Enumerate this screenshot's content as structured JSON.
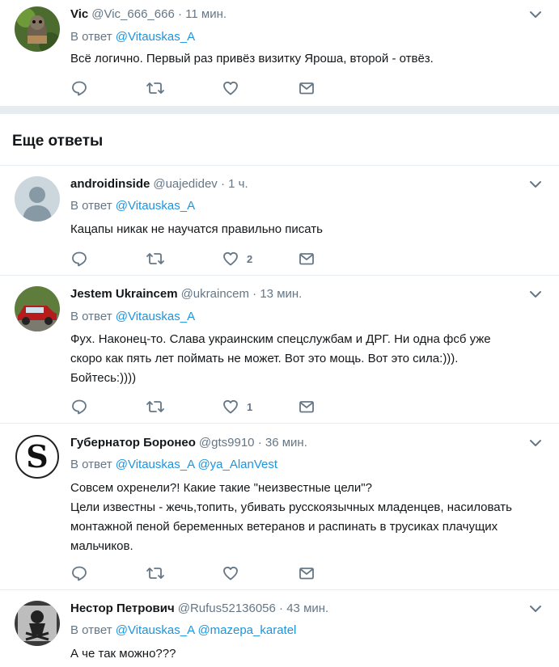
{
  "reply_prefix": "В ответ",
  "section_title": "Еще ответы",
  "colors": {
    "link": "#1b95e0",
    "muted": "#657786",
    "text": "#14171a",
    "border": "#e6ecf0"
  },
  "tweets": [
    {
      "name": "Vic",
      "handle": "@Vic_666_666",
      "time": "11 мин.",
      "mentions": [
        "@Vitauskas_A"
      ],
      "lines": [
        "Всё логично. Первый раз привёз визитку Яроша, второй - отвёз."
      ],
      "likes": ""
    },
    {
      "name": "androidinside",
      "handle": "@uajedidev",
      "time": "1 ч.",
      "mentions": [
        "@Vitauskas_A"
      ],
      "lines": [
        "Кацапы никак не научатся правильно писать"
      ],
      "likes": "2"
    },
    {
      "name": "Jestem Ukraincem",
      "handle": "@ukraincem",
      "time": "13 мин.",
      "mentions": [
        "@Vitauskas_A"
      ],
      "lines": [
        "Фух. Наконец-то. Слава украинским спецслужбам и ДРГ. Ни одна фсб уже",
        "скоро как пять лет поймать не может. Вот это мощь. Вот это сила:))).",
        "Бойтесь:))))"
      ],
      "likes": "1"
    },
    {
      "name": "Губернатор Боронео",
      "handle": "@gts9910",
      "time": "36 мин.",
      "mentions": [
        "@Vitauskas_A",
        "@ya_AlanVest"
      ],
      "lines": [
        "Совсем охренели?! Какие такие \"неизвестные цели\"?",
        "Цели известны - жечь,топить, убивать русскоязычных младенцев, насиловать",
        "монтажной пеной беременных ветеранов и распинать в трусиках плачущих",
        "мальчиков."
      ],
      "likes": ""
    },
    {
      "name": "Нестор Петрович",
      "handle": "@Rufus52136056",
      "time": "43 мин.",
      "mentions": [
        "@Vitauskas_A",
        "@mazepa_karatel"
      ],
      "lines": [
        "А че так можно???"
      ],
      "likes": ""
    }
  ],
  "icons": {
    "reply": "reply-icon",
    "retweet": "retweet-icon",
    "like": "heart-icon",
    "dm": "envelope-icon",
    "menu": "chevron-down-icon"
  }
}
